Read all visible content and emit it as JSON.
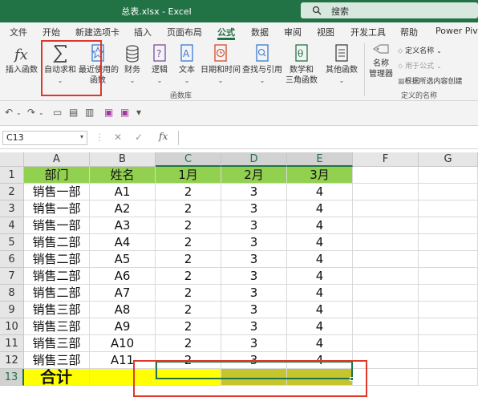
{
  "window": {
    "title": "总表.xlsx  -  Excel",
    "search_placeholder": "搜索"
  },
  "tabs": [
    {
      "label": "文件"
    },
    {
      "label": "开始"
    },
    {
      "label": "新建选项卡"
    },
    {
      "label": "插入"
    },
    {
      "label": "页面布局"
    },
    {
      "label": "公式"
    },
    {
      "label": "数据"
    },
    {
      "label": "审阅"
    },
    {
      "label": "视图"
    },
    {
      "label": "开发工具"
    },
    {
      "label": "帮助"
    },
    {
      "label": "Power Pivo"
    }
  ],
  "ribbon": {
    "function_library": {
      "group_label": "函数库",
      "insert_function": "插入函数",
      "autosum": "自动求和",
      "recent_line1": "最近使用的",
      "recent_line2": "函数",
      "financial": "财务",
      "logical": "逻辑",
      "text": "文本",
      "datetime": "日期和时间",
      "lookup": "查找与引用",
      "math_line1": "数学和",
      "math_line2": "三角函数",
      "more": "其他函数"
    },
    "defined_names": {
      "group_label": "定义的名称",
      "name_manager_line1": "名称",
      "name_manager_line2": "管理器",
      "define_name": "定义名称",
      "use_in_formula": "用于公式",
      "create_from_selection": "根据所选内容创建"
    }
  },
  "formula_bar": {
    "name_box": "C13",
    "formula": ""
  },
  "sheet": {
    "columns": [
      "A",
      "B",
      "C",
      "D",
      "E",
      "F",
      "G"
    ],
    "selected_columns": [
      "C",
      "D",
      "E"
    ],
    "selected_row": 13,
    "header_row": [
      "部门",
      "姓名",
      "1月",
      "2月",
      "3月"
    ],
    "rows": [
      [
        "销售一部",
        "A1",
        "2",
        "3",
        "4"
      ],
      [
        "销售一部",
        "A2",
        "2",
        "3",
        "4"
      ],
      [
        "销售一部",
        "A3",
        "2",
        "3",
        "4"
      ],
      [
        "销售二部",
        "A4",
        "2",
        "3",
        "4"
      ],
      [
        "销售二部",
        "A5",
        "2",
        "3",
        "4"
      ],
      [
        "销售二部",
        "A6",
        "2",
        "3",
        "4"
      ],
      [
        "销售二部",
        "A7",
        "2",
        "3",
        "4"
      ],
      [
        "销售三部",
        "A8",
        "2",
        "3",
        "4"
      ],
      [
        "销售三部",
        "A9",
        "2",
        "3",
        "4"
      ],
      [
        "销售三部",
        "A10",
        "2",
        "3",
        "4"
      ],
      [
        "销售三部",
        "A11",
        "2",
        "3",
        "4"
      ]
    ],
    "total_label": "合计",
    "row_numbers": [
      "1",
      "2",
      "3",
      "4",
      "5",
      "6",
      "7",
      "8",
      "9",
      "10",
      "11",
      "12",
      "13"
    ]
  },
  "colors": {
    "excel_green": "#217346",
    "header_fill": "#92d050",
    "total_fill": "#ffff00",
    "highlight_red": "#e0372b"
  },
  "icons": [
    "search-icon",
    "fx-icon",
    "sigma-icon",
    "star-book-icon",
    "financial-icon",
    "logical-icon",
    "text-icon",
    "datetime-icon",
    "lookup-icon",
    "math-icon",
    "more-functions-icon",
    "name-manager-icon",
    "undo-icon",
    "redo-icon",
    "save-icon"
  ]
}
